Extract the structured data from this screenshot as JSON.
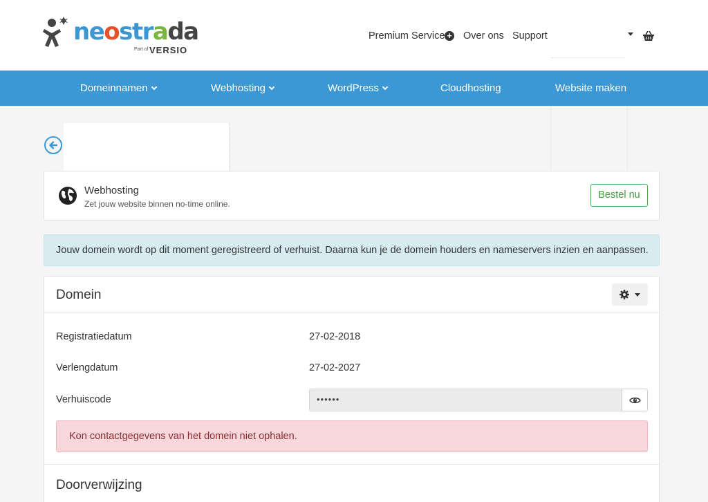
{
  "brand": {
    "logo_part1": "ne",
    "logo_part2": "o",
    "logo_part3": "str",
    "logo_part4": "a",
    "logo_part5": "da",
    "part_of": "Part of",
    "parent": "VERSIO",
    "colors": {
      "blue": "#3b96d2",
      "orange": "#e8502a",
      "green": "#79b83c"
    }
  },
  "topnav": {
    "premium": "Premium Service",
    "about": "Over ons",
    "support": "Support"
  },
  "mainnav": {
    "items": [
      "Domeinnamen",
      "Webhosting",
      "WordPress",
      "Cloudhosting",
      "Website maken"
    ]
  },
  "promo": {
    "title": "Webhosting",
    "subtitle": "Zet jouw website binnen no-time online.",
    "button": "Bestel nu"
  },
  "info_alert": "Jouw domein wordt op dit moment geregistreerd of verhuist. Daarna kun je de domein houders en nameservers inzien en aanpassen.",
  "domain_panel": {
    "title": "Domein",
    "rows": [
      {
        "label": "Registratiedatum",
        "value": "27-02-2018"
      },
      {
        "label": "Verlengdatum",
        "value": "27-02-2027"
      },
      {
        "label": "Verhuiscode",
        "value": "••••••"
      }
    ],
    "error": "Kon contactgegevens van het domein niet ophalen."
  },
  "redirect_panel": {
    "title": "Doorverwijzing"
  },
  "accent_color": "#3c98d4"
}
